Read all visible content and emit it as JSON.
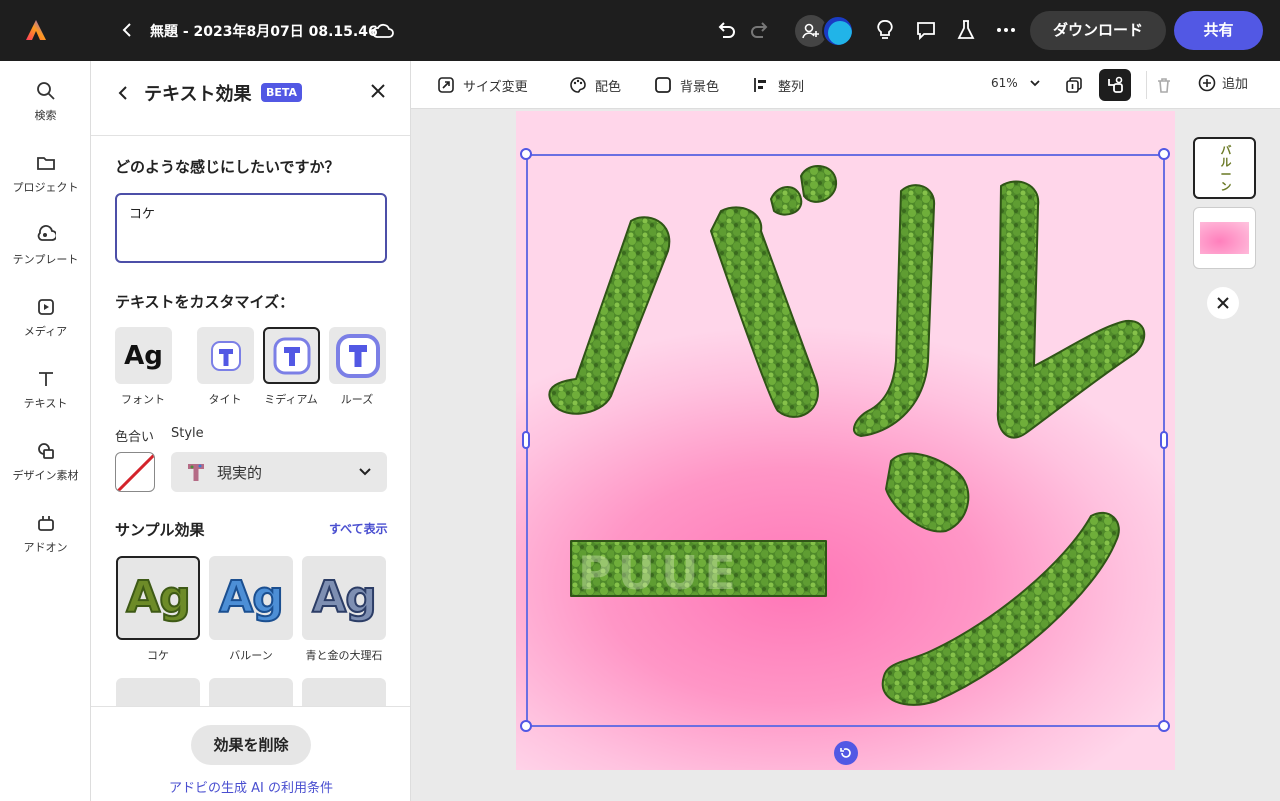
{
  "header": {
    "doc_title": "無題 - 2023年8月07日 08.15.46",
    "download_label": "ダウンロード",
    "share_label": "共有"
  },
  "rail": {
    "items": [
      {
        "label": "検索",
        "icon": "search-icon"
      },
      {
        "label": "プロジェクト",
        "icon": "folder-icon"
      },
      {
        "label": "テンプレート",
        "icon": "template-icon"
      },
      {
        "label": "メディア",
        "icon": "media-icon"
      },
      {
        "label": "テキスト",
        "icon": "text-icon"
      },
      {
        "label": "デザイン素材",
        "icon": "shapes-icon"
      },
      {
        "label": "アドオン",
        "icon": "addons-icon"
      }
    ]
  },
  "panel": {
    "title": "テキスト効果",
    "badge": "BETA",
    "question": "どのような感じにしたいですか？",
    "prompt_value": "コケ",
    "customize_title": "テキストをカスタマイズ：",
    "options": [
      {
        "label": "フォント",
        "glyph": "Ag"
      },
      {
        "label": "タイト",
        "glyph": "T"
      },
      {
        "label": "ミディアム",
        "glyph": "T"
      },
      {
        "label": "ルーズ",
        "glyph": "T"
      }
    ],
    "color_label": "色合い",
    "style_label": "Style",
    "style_value": "現実的",
    "samples_title": "サンプル効果",
    "see_all": "すべて表示",
    "samples": [
      {
        "label": "コケ",
        "glyph": "Ag"
      },
      {
        "label": "バルーン",
        "glyph": "Ag"
      },
      {
        "label": "青と金の大理石",
        "glyph": "Ag"
      }
    ],
    "remove_label": "効果を削除",
    "terms_link": "アドビの生成 AI の利用条件"
  },
  "toolbar": {
    "resize": "サイズ変更",
    "color": "配色",
    "background": "背景色",
    "align": "整列",
    "zoom": "61%",
    "add": "追加"
  },
  "canvas": {
    "text_main": "バルーン",
    "text_sub": "PUUE"
  },
  "pages": {
    "thumb1_text": "バルーン"
  },
  "colors": {
    "accent": "#5258e4",
    "moss": "#4f8a2a",
    "canvas_pink": "#ff8fc3"
  }
}
